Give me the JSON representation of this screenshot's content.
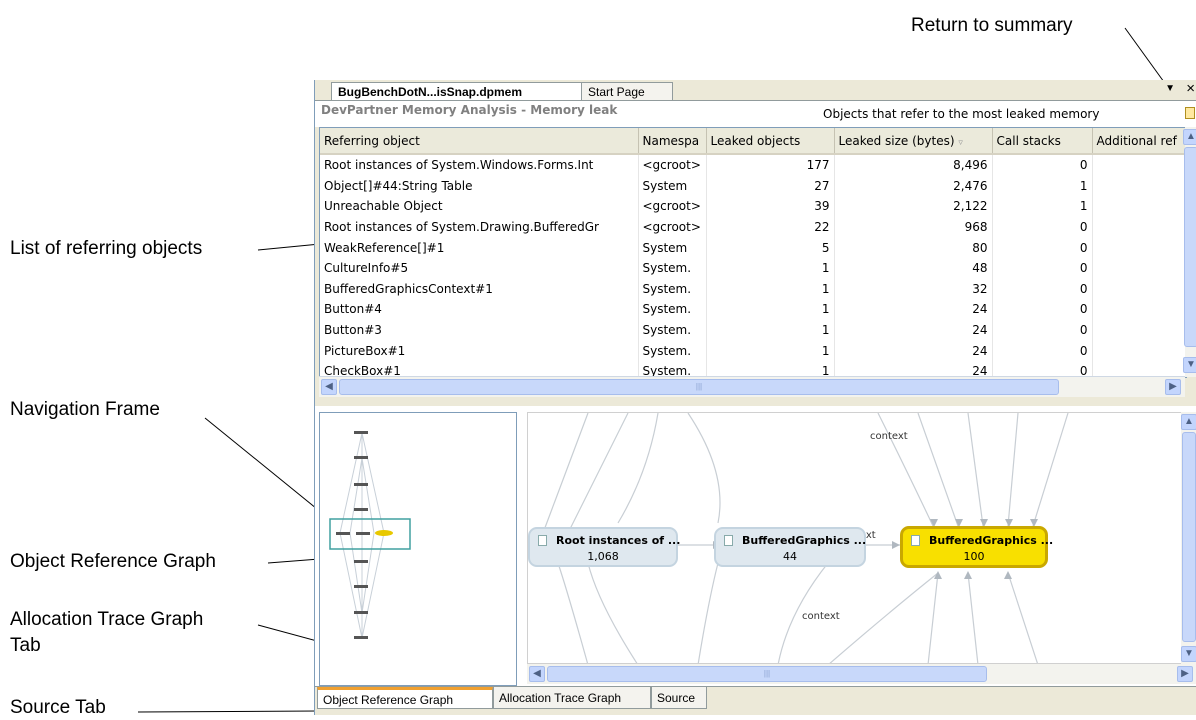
{
  "callouts": {
    "return_to_summary": "Return to summary",
    "list_referring": "List of referring objects",
    "navigation_frame": "Navigation Frame",
    "object_graph": "Object Reference Graph",
    "alloc_tab_line1": "Allocation Trace Graph",
    "alloc_tab_line2": "Tab",
    "source_tab": "Source Tab"
  },
  "doc_tabs": {
    "active": "BugBenchDotN...isSnap.dpmem",
    "start": "Start Page",
    "close_glyph": "×",
    "pin_glyph": "▼"
  },
  "header": {
    "product_title": "DevPartner Memory Analysis - Memory leak",
    "view_title": "Objects that refer to the most leaked memory"
  },
  "table": {
    "columns": [
      "Referring object",
      "Namespa",
      "Leaked objects",
      "Leaked size (bytes)",
      "Call stacks",
      "Additional ref"
    ],
    "sort_indicator": "▿",
    "rows": [
      [
        "Root instances of System.Windows.Forms.Int",
        "<gcroot>",
        "177",
        "8,496",
        "0",
        ""
      ],
      [
        "Object[]#44:String Table",
        "System",
        "27",
        "2,476",
        "1",
        ""
      ],
      [
        "Unreachable Object",
        "<gcroot>",
        "39",
        "2,122",
        "1",
        ""
      ],
      [
        "Root instances of System.Drawing.BufferedGr",
        "<gcroot>",
        "22",
        "968",
        "0",
        ""
      ],
      [
        "WeakReference[]#1",
        "System",
        "5",
        "80",
        "0",
        ""
      ],
      [
        "CultureInfo#5",
        "System.",
        "1",
        "48",
        "0",
        ""
      ],
      [
        "BufferedGraphicsContext#1",
        "System.",
        "1",
        "32",
        "0",
        ""
      ],
      [
        "Button#4",
        "System.",
        "1",
        "24",
        "0",
        ""
      ],
      [
        "Button#3",
        "System.",
        "1",
        "24",
        "0",
        ""
      ],
      [
        "PictureBox#1",
        "System.",
        "1",
        "24",
        "0",
        ""
      ],
      [
        "CheckBox#1",
        "System.",
        "1",
        "24",
        "0",
        ""
      ]
    ]
  },
  "graph": {
    "nodes": [
      {
        "title": "Root instances of ...",
        "value": "1,068"
      },
      {
        "title": "BufferedGraphics ...",
        "value": "44"
      },
      {
        "title": "BufferedGraphics ...",
        "value": "100"
      }
    ],
    "edge_labels": [
      "context",
      "context",
      "context"
    ]
  },
  "bottom_tabs": {
    "object_reference_graph": "Object Reference Graph",
    "allocation_trace_graph": "Allocation Trace Graph",
    "source": "Source"
  },
  "scroll": {
    "up": "▲",
    "down": "▼",
    "left": "◀",
    "right": "▶",
    "grip": "|||"
  },
  "colors": {
    "selected_node_fill": "#f8e000",
    "node_fill": "#dfe8ef",
    "accent_tab": "#f0a030"
  }
}
